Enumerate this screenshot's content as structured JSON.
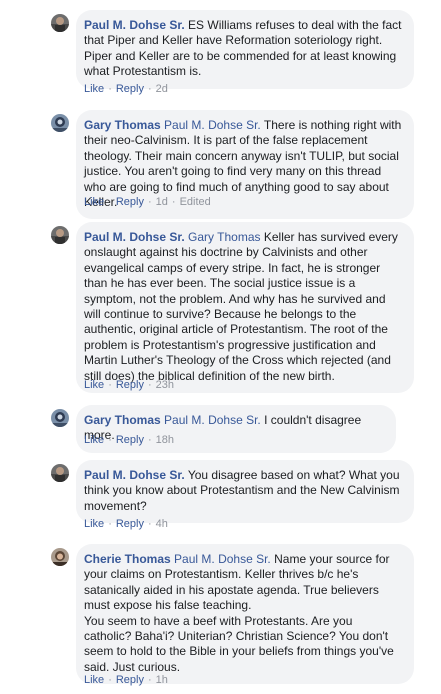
{
  "comments": [
    {
      "author": "Paul M. Dohse Sr.",
      "avatar": "paul-avatar",
      "mention": "",
      "text": "ES Williams refuses to deal with the fact that Piper and Keller have Reformation soteriology right. Piper and Keller are to be commended for at least knowing what Protestantism is.",
      "like": "Like",
      "reply": "Reply",
      "time": "2d",
      "edited": ""
    },
    {
      "author": "Gary Thomas",
      "avatar": "gary-avatar",
      "mention": "Paul M. Dohse Sr.",
      "text": "There is nothing right with their neo-Calvinism. It is part of the false replacement theology. Their main concern anyway isn't TULIP, but social justice. You aren't going to find very many on this thread who are going to find much of anything good to say about Keller.",
      "like": "Like",
      "reply": "Reply",
      "time": "1d",
      "edited": "Edited"
    },
    {
      "author": "Paul M. Dohse Sr.",
      "avatar": "paul-avatar",
      "mention": "Gary Thomas",
      "text": "Keller has survived every onslaught against his doctrine by Calvinists and other evangelical camps of every stripe. In fact, he is stronger than he has ever been. The social justice issue is a symptom, not the problem. And why has he survived and will continue to survive? Because he belongs to the authentic, original article of Protestantism. The root of the problem is Protestantism's progressive justification and Martin Luther's Theology of the Cross which rejected (and still does) the biblical definition of the new birth.",
      "like": "Like",
      "reply": "Reply",
      "time": "23h",
      "edited": ""
    },
    {
      "author": "Gary Thomas",
      "avatar": "gary-avatar",
      "mention": "Paul M. Dohse Sr.",
      "text": "I couldn't disagree more.",
      "like": "Like",
      "reply": "Reply",
      "time": "18h",
      "edited": ""
    },
    {
      "author": "Paul M. Dohse Sr.",
      "avatar": "paul-avatar",
      "mention": "",
      "text": "You disagree based on what? What you think you know about Protestantism and the New Calvinism movement?",
      "like": "Like",
      "reply": "Reply",
      "time": "4h",
      "edited": ""
    },
    {
      "author": "Cherie Thomas",
      "avatar": "cherie-avatar",
      "mention": "Paul M. Dohse Sr.",
      "text": "Name your source for your claims on Protestantism. Keller thrives b/c he's satanically aided in his apostate agenda. True believers must expose his false teaching.\nYou seem to have a beef with Protestants. Are you catholic? Baha'i? Uniterian? Christian Science? You don't seem to hold to the Bible in your beliefs from things you've said. Just curious.",
      "like": "Like",
      "reply": "Reply",
      "time": "1h",
      "edited": ""
    }
  ],
  "colors": {
    "name_link": "#385898",
    "bubble_bg": "#f2f3f5",
    "meta_text": "#90949c",
    "body_text": "#1c1e21"
  }
}
